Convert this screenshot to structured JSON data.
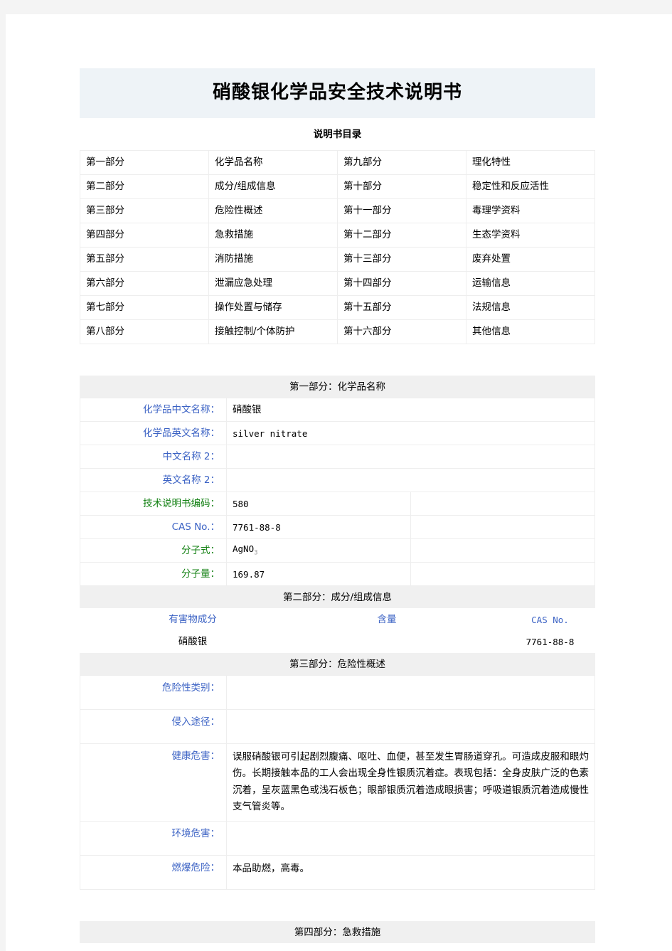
{
  "document": {
    "title": "硝酸银化学品安全技术说明书",
    "toc_title": "说明书目录"
  },
  "toc": {
    "rows": [
      {
        "left_no": "第一部分",
        "left_name": "化学品名称",
        "right_no": "第九部分",
        "right_name": "理化特性"
      },
      {
        "left_no": "第二部分",
        "left_name": "成分/组成信息",
        "right_no": "第十部分",
        "right_name": "稳定性和反应活性"
      },
      {
        "left_no": "第三部分",
        "left_name": "危险性概述",
        "right_no": "第十一部分",
        "right_name": "毒理学资料"
      },
      {
        "left_no": "第四部分",
        "left_name": "急救措施",
        "right_no": "第十二部分",
        "right_name": "生态学资料"
      },
      {
        "left_no": "第五部分",
        "left_name": "消防措施",
        "right_no": "第十三部分",
        "right_name": "废弃处置"
      },
      {
        "left_no": "第六部分",
        "left_name": "泄漏应急处理",
        "right_no": "第十四部分",
        "right_name": "运输信息"
      },
      {
        "left_no": "第七部分",
        "left_name": "操作处置与储存",
        "right_no": "第十五部分",
        "right_name": "法规信息"
      },
      {
        "left_no": "第八部分",
        "left_name": "接触控制/个体防护",
        "right_no": "第十六部分",
        "right_name": "其他信息"
      }
    ]
  },
  "section1": {
    "header": "第一部分：化学品名称",
    "rows": [
      {
        "label": "化学品中文名称：",
        "value": "硝酸银"
      },
      {
        "label": "化学品英文名称：",
        "value": "silver nitrate"
      },
      {
        "label": "中文名称 2：",
        "value": ""
      },
      {
        "label": "英文名称 2：",
        "value": ""
      }
    ],
    "rows2": [
      {
        "label": "技术说明书编码：",
        "value": "580",
        "label_color": "green"
      },
      {
        "label": "CAS No.：",
        "value": "7761-88-8",
        "label_color": "blue"
      },
      {
        "label": "分子式：",
        "value_base": "AgNO",
        "value_sub": "3",
        "label_color": "green"
      },
      {
        "label": "分子量：",
        "value": "169.87",
        "label_color": "green"
      }
    ]
  },
  "section2": {
    "header": "第二部分：成分/组成信息",
    "columns": [
      "有害物成分",
      "含量",
      "CAS No."
    ],
    "row": {
      "component": "硝酸银",
      "content": "",
      "cas": "7761-88-8"
    }
  },
  "section3": {
    "header": "第三部分：危险性概述",
    "rows": [
      {
        "label": "危险性类别：",
        "value": ""
      },
      {
        "label": "侵入途径：",
        "value": ""
      },
      {
        "label": "健康危害：",
        "value": "误服硝酸银可引起剧烈腹痛、呕吐、血便，甚至发生胃肠道穿孔。可造成皮服和眼灼伤。长期接触本品的工人会出现全身性银质沉着症。表现包括：全身皮肤广泛的色素沉着，呈灰蓝黑色或浅石板色；眼部银质沉着造成眼损害；呼吸道银质沉着造成慢性支气管炎等。"
      },
      {
        "label": "环境危害：",
        "value": ""
      },
      {
        "label": "燃爆危险：",
        "value": "本品助燃，高毒。"
      }
    ]
  },
  "section4": {
    "header": "第四部分：急救措施"
  }
}
